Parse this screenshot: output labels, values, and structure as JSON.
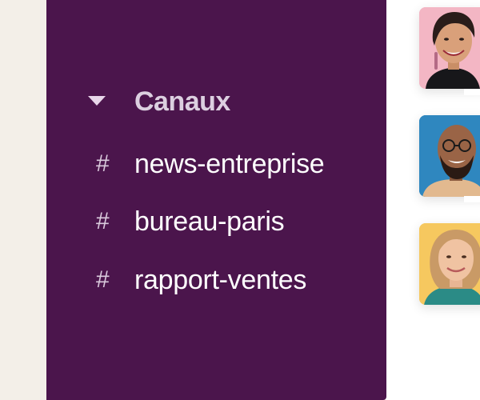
{
  "sidebar": {
    "section": {
      "label": "Canaux",
      "expanded": true
    },
    "channels": [
      {
        "prefix": "#",
        "name": "news-entreprise"
      },
      {
        "prefix": "#",
        "name": "bureau-paris"
      },
      {
        "prefix": "#",
        "name": "rapport-ventes"
      }
    ]
  },
  "colors": {
    "sidebar_bg": "#4b154c",
    "page_bg": "#f3efe8",
    "avatar_1_bg": "#f3b6c4",
    "avatar_2_bg": "#2f87bf",
    "avatar_3_bg": "#f6c85f"
  }
}
